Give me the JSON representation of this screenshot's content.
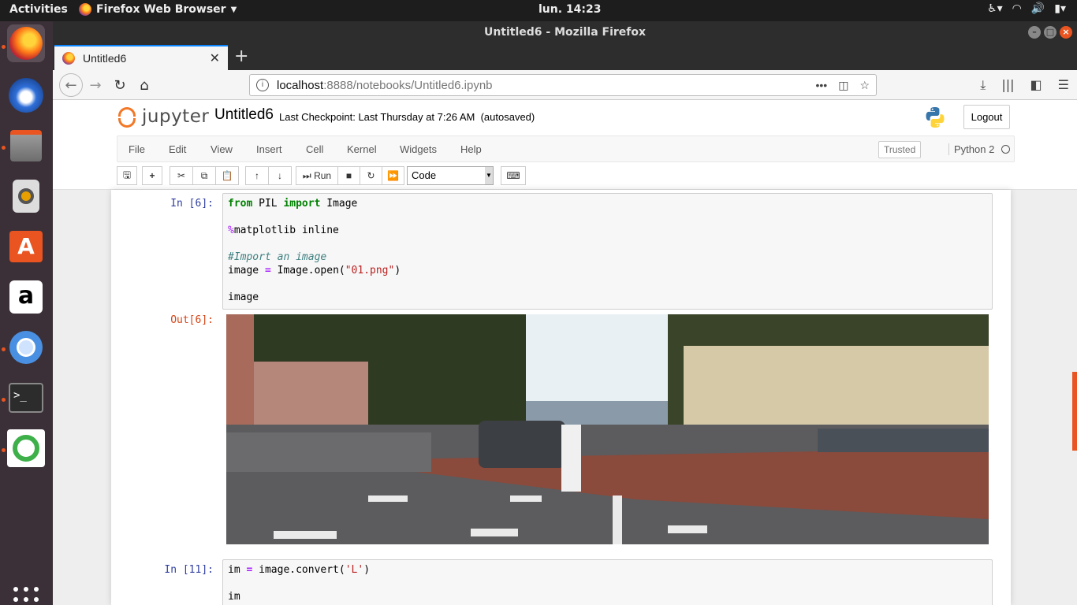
{
  "topbar": {
    "activities": "Activities",
    "app_name": "Firefox Web Browser",
    "clock": "lun. 14:23"
  },
  "window": {
    "title": "Untitled6 - Mozilla Firefox"
  },
  "tab": {
    "title": "Untitled6"
  },
  "url": {
    "host": "localhost",
    "path": ":8888/notebooks/Untitled6.ipynb"
  },
  "jupyter": {
    "logo_text": "jupyter",
    "notebook_name": "Untitled6",
    "checkpoint": "Last Checkpoint: Last Thursday at 7:26 AM",
    "autosave": "(autosaved)",
    "logout": "Logout",
    "menu": [
      "File",
      "Edit",
      "View",
      "Insert",
      "Cell",
      "Kernel",
      "Widgets",
      "Help"
    ],
    "trusted": "Trusted",
    "kernel": "Python 2",
    "run_label": "Run",
    "cell_type": "Code"
  },
  "cells": [
    {
      "in_prompt": "In [6]:",
      "lines": [
        [
          {
            "t": "from",
            "c": "kw"
          },
          {
            "t": " PIL ",
            "c": ""
          },
          {
            "t": "import",
            "c": "kw"
          },
          {
            "t": " Image",
            "c": ""
          }
        ],
        [],
        [
          {
            "t": "%",
            "c": "magic"
          },
          {
            "t": "matplotlib inline",
            "c": ""
          }
        ],
        [],
        [
          {
            "t": "#Import an image",
            "c": "cm"
          }
        ],
        [
          {
            "t": "image ",
            "c": ""
          },
          {
            "t": "=",
            "c": "op"
          },
          {
            "t": " Image.open(",
            "c": ""
          },
          {
            "t": "\"01.png\"",
            "c": "str"
          },
          {
            "t": ")",
            "c": ""
          }
        ],
        [],
        [
          {
            "t": "image",
            "c": ""
          }
        ]
      ],
      "out_prompt": "Out[6]:"
    },
    {
      "in_prompt": "In [11]:",
      "lines": [
        [
          {
            "t": "im ",
            "c": ""
          },
          {
            "t": "=",
            "c": "op"
          },
          {
            "t": " image.convert(",
            "c": ""
          },
          {
            "t": "'L'",
            "c": "str"
          },
          {
            "t": ")",
            "c": ""
          }
        ],
        [],
        [
          {
            "t": "im",
            "c": ""
          }
        ]
      ]
    }
  ]
}
